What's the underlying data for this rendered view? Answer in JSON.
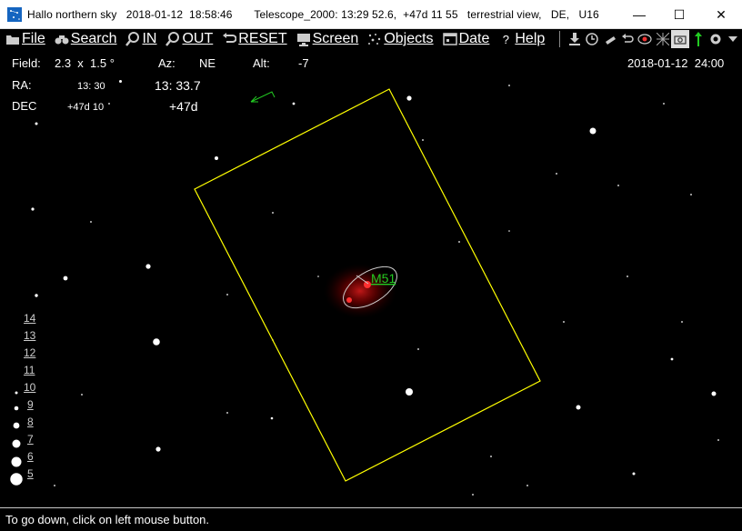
{
  "window": {
    "title": "Hallo northern sky   2018-01-12  18:58:46       Telescope_2000: 13:29 52.6,  +47d 11 55   terrestrial view,   DE,   U16",
    "minimize": "—",
    "maximize": "☐",
    "close": "✕"
  },
  "menu": {
    "file": "File",
    "search": "Search",
    "zoom_in": "IN",
    "zoom_out": "OUT",
    "reset": "RESET",
    "screen": "Screen",
    "objects": "Objects",
    "date": "Date",
    "help": "Help"
  },
  "info": {
    "field_label": "Field:",
    "field_value": "2.3  x  1.5 °",
    "az_label": "Az:",
    "az_value": "NE",
    "alt_label": "Alt:",
    "alt_value": "-7",
    "datetime": "2018-01-12  24:00",
    "ra_label": "RA:",
    "ra_tick": "13: 30",
    "ra_center": "13: 33.7",
    "dec_label": "DEC",
    "dec_tick": "+47d 10",
    "dec_center": "+47d"
  },
  "sky": {
    "object_label": "M51",
    "frame_color": "#ffff00",
    "galaxy_color": "#ff2020",
    "label_color": "#22cc22"
  },
  "magnitudes": [
    "14",
    "13",
    "12",
    "11",
    "10",
    "9",
    "8",
    "7",
    "6",
    "5"
  ],
  "status": "To go down, click on left mouse button."
}
